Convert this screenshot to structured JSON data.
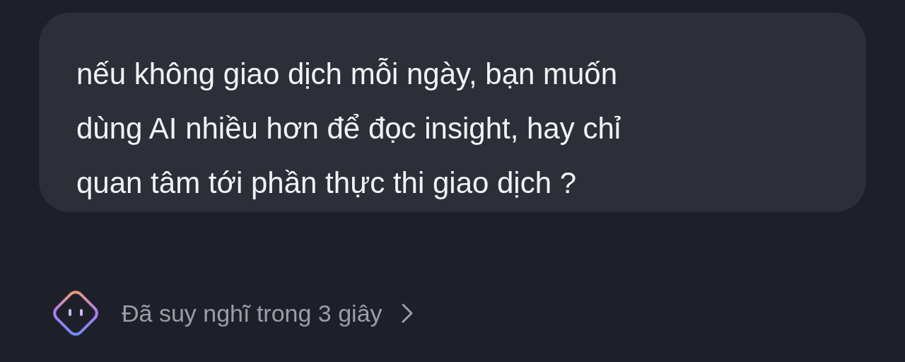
{
  "message": {
    "lines": [
      "nếu không giao dịch mỗi ngày, bạn muốn",
      "dùng AI nhiều hơn để đọc insight, hay chỉ",
      "quan tâm tới phần thực thi giao dịch ?"
    ]
  },
  "thinking": {
    "label": "Đã suy nghĩ trong 3 giây",
    "expanded": false
  }
}
